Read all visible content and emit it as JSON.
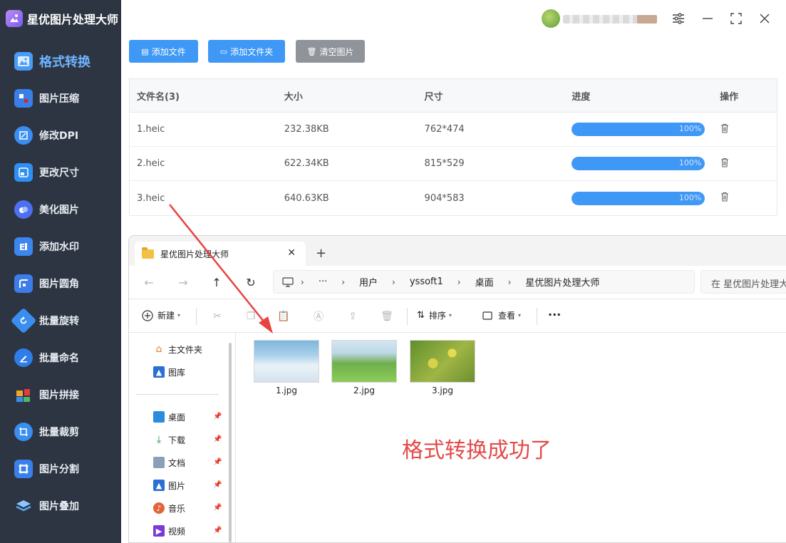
{
  "app": {
    "title": "星优图片处理大师"
  },
  "sidebar": {
    "items": [
      {
        "label": "格式转换",
        "icon": "image-convert-icon",
        "color": "#4a9bf5"
      },
      {
        "label": "图片压缩",
        "icon": "compress-icon",
        "color": "#3a7ee8"
      },
      {
        "label": "修改DPI",
        "icon": "dpi-icon",
        "color": "#3a8ef0"
      },
      {
        "label": "更改尺寸",
        "icon": "resize-icon",
        "color": "#2f8ff2"
      },
      {
        "label": "美化图片",
        "icon": "beautify-icon",
        "color": "#4d6ff0"
      },
      {
        "label": "添加水印",
        "icon": "watermark-icon",
        "color": "#3b86ef"
      },
      {
        "label": "图片圆角",
        "icon": "round-corner-icon",
        "color": "#3d7de9"
      },
      {
        "label": "批量旋转",
        "icon": "rotate-icon",
        "color": "#3a8ef0"
      },
      {
        "label": "批量命名",
        "icon": "rename-icon",
        "color": "#2f7de8"
      },
      {
        "label": "图片拼接",
        "icon": "puzzle-icon",
        "color": "#3f8cf0"
      },
      {
        "label": "批量裁剪",
        "icon": "crop-icon",
        "color": "#3a8ef0"
      },
      {
        "label": "图片分割",
        "icon": "split-icon",
        "color": "#3a80ea"
      },
      {
        "label": "图片叠加",
        "icon": "layers-icon",
        "color": "#5aa7f7"
      }
    ]
  },
  "toolbar": {
    "add_file": "添加文件",
    "add_folder": "添加文件夹",
    "clear": "清空图片"
  },
  "table": {
    "headers": [
      "文件名(3)",
      "大小",
      "尺寸",
      "进度",
      "操作"
    ],
    "rows": [
      {
        "name": "1.heic",
        "size": "232.38KB",
        "dims": "762*474",
        "progress": 100,
        "progress_text": "100%"
      },
      {
        "name": "2.heic",
        "size": "622.34KB",
        "dims": "815*529",
        "progress": 100,
        "progress_text": "100%"
      },
      {
        "name": "3.heic",
        "size": "640.63KB",
        "dims": "904*583",
        "progress": 100,
        "progress_text": "100%"
      }
    ]
  },
  "explorer": {
    "tab_title": "星优图片处理大师",
    "path": [
      "用户",
      "yssoft1",
      "桌面",
      "星优图片处理大师"
    ],
    "ellipsis": "···",
    "search_placeholder": "在 星优图片处理大师 中搜索",
    "commands": {
      "new": "新建",
      "sort": "排序",
      "view": "查看",
      "more": "···"
    },
    "tree": [
      {
        "label": "主文件夹",
        "icon": "home-icon",
        "pinned": false
      },
      {
        "label": "图库",
        "icon": "gallery-icon",
        "pinned": false
      },
      {
        "label": "桌面",
        "icon": "desktop-icon",
        "pinned": true
      },
      {
        "label": "下载",
        "icon": "download-icon",
        "pinned": true
      },
      {
        "label": "文档",
        "icon": "document-icon",
        "pinned": true
      },
      {
        "label": "图片",
        "icon": "pictures-icon",
        "pinned": true
      },
      {
        "label": "音乐",
        "icon": "music-icon",
        "pinned": true
      },
      {
        "label": "视频",
        "icon": "video-icon",
        "pinned": true
      }
    ],
    "files": [
      {
        "name": "1.jpg"
      },
      {
        "name": "2.jpg"
      },
      {
        "name": "3.jpg"
      }
    ],
    "annotation": "格式转换成功了"
  },
  "colors": {
    "sidebar_bg": "#2d3542",
    "accent": "#3f98f5",
    "annotation": "#e34a4a"
  }
}
